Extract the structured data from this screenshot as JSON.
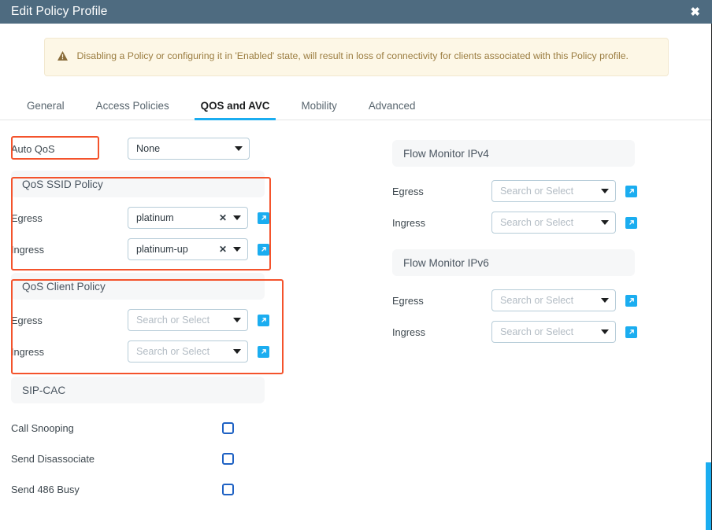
{
  "window": {
    "title": "Edit Policy Profile",
    "close_label": "✖"
  },
  "banner": {
    "icon": "warning-triangle-icon",
    "text": "Disabling a Policy or configuring it in 'Enabled' state, will result in loss of connectivity for clients associated with this Policy profile."
  },
  "tabs": [
    {
      "label": "General",
      "active": false
    },
    {
      "label": "Access Policies",
      "active": false
    },
    {
      "label": "QOS and AVC",
      "active": true
    },
    {
      "label": "Mobility",
      "active": false
    },
    {
      "label": "Advanced",
      "active": false
    }
  ],
  "left_column": {
    "auto_qos": {
      "label": "Auto QoS",
      "value": "None"
    },
    "qos_ssid_policy": {
      "title": "QoS SSID Policy",
      "egress": {
        "label": "Egress",
        "value": "platinum",
        "clear": "✕"
      },
      "ingress": {
        "label": "Ingress",
        "value": "platinum-up",
        "clear": "✕"
      }
    },
    "qos_client_policy": {
      "title": "QoS Client Policy",
      "egress": {
        "label": "Egress",
        "placeholder": "Search or Select"
      },
      "ingress": {
        "label": "Ingress",
        "placeholder": "Search or Select"
      }
    },
    "sip_cac": {
      "title": "SIP-CAC",
      "items": [
        {
          "label": "Call Snooping",
          "checked": false
        },
        {
          "label": "Send Disassociate",
          "checked": false
        },
        {
          "label": "Send 486 Busy",
          "checked": false
        }
      ]
    }
  },
  "right_column": {
    "flow_monitor_ipv4": {
      "title": "Flow Monitor IPv4",
      "egress": {
        "label": "Egress",
        "placeholder": "Search or Select"
      },
      "ingress": {
        "label": "Ingress",
        "placeholder": "Search or Select"
      }
    },
    "flow_monitor_ipv6": {
      "title": "Flow Monitor IPv6",
      "egress": {
        "label": "Egress",
        "placeholder": "Search or Select"
      },
      "ingress": {
        "label": "Ingress",
        "placeholder": "Search or Select"
      }
    }
  },
  "colors": {
    "header_bg": "#4e6b80",
    "accent_blue": "#1badf0",
    "annotation_red": "#f4532c",
    "banner_bg": "#fdf7e6",
    "banner_text": "#9b7d41",
    "checkbox_blue": "#1f62c4"
  }
}
